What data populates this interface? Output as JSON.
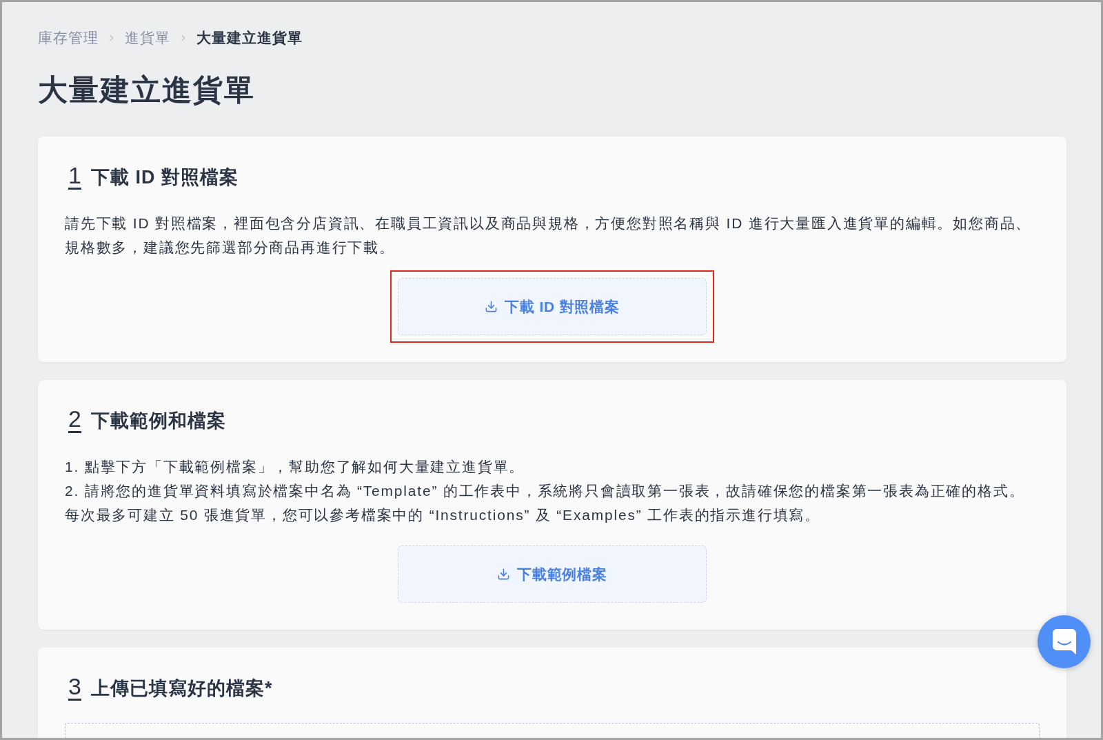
{
  "breadcrumb": [
    {
      "label": "庫存管理",
      "current": false
    },
    {
      "label": "進貨單",
      "current": false
    },
    {
      "label": "大量建立進貨單",
      "current": true
    }
  ],
  "page_title": "大量建立進貨單",
  "sections": [
    {
      "kind": "download",
      "step": "1",
      "title": "下載 ID 對照檔案",
      "paragraphs": [
        "請先下載 ID 對照檔案，裡面包含分店資訊、在職員工資訊以及商品與規格，方便您對照名稱與 ID 進行大量匯入進貨單的編輯。如您商品、規格數多，建議您先篩選部分商品再進行下載。"
      ],
      "button": {
        "label": "下載 ID 對照檔案",
        "highlighted": true
      }
    },
    {
      "kind": "download",
      "step": "2",
      "title": "下載範例和檔案",
      "paragraphs": [
        "1. 點擊下方「下載範例檔案」，幫助您了解如何大量建立進貨單。",
        "2. 請將您的進貨單資料填寫於檔案中名為 “Template” 的工作表中，系統將只會讀取第一張表，故請確保您的檔案第一張表為正確的格式。每次最多可建立 50 張進貨單，您可以參考檔案中的 “Instructions” 及 “Examples” 工作表的指示進行填寫。"
      ],
      "button": {
        "label": "下載範例檔案",
        "highlighted": false
      }
    },
    {
      "kind": "upload",
      "step": "3",
      "title": "上傳已填寫好的檔案*"
    }
  ]
}
